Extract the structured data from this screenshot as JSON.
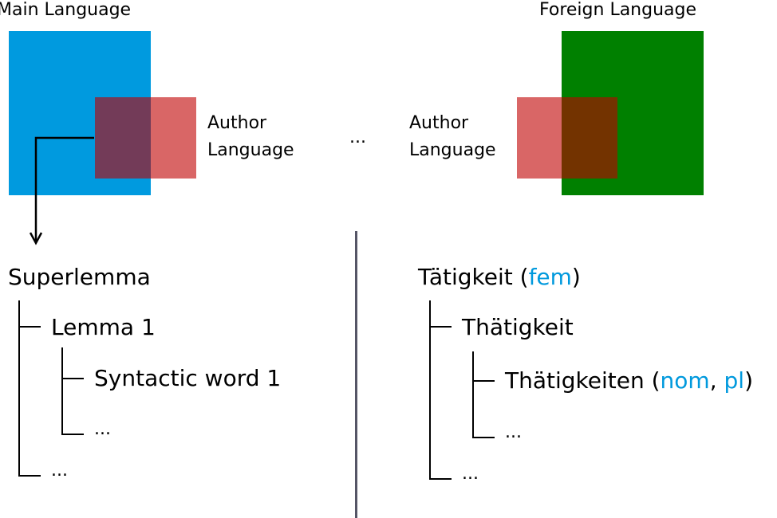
{
  "colors": {
    "main_language": "#009ADF",
    "author_language": "#D96666",
    "main_author_overlap": "#733B58",
    "foreign_language": "#008000",
    "foreign_author_overlap": "#733300",
    "tag_color": "#0099DD",
    "divider": "#555566"
  },
  "top": {
    "main_language_label": "Main Language",
    "foreign_language_label": "Foreign Language",
    "author_language_left": [
      "Author",
      "Language"
    ],
    "author_language_right": [
      "Author",
      "Language"
    ],
    "middle_ellipsis": "..."
  },
  "left_tree": {
    "root": "Superlemma",
    "level1": "Lemma 1",
    "level2": "Syntactic word 1",
    "level2_more": "...",
    "level1_more": "..."
  },
  "right_tree": {
    "root": "Tätigkeit",
    "root_tag": "fem",
    "level1": "Thätigkeit",
    "level2": "Thätigkeiten",
    "level2_tags": [
      "nom",
      "pl"
    ],
    "level2_more": "...",
    "level1_more": "..."
  },
  "punct": {
    "open": " (",
    "close": ")",
    "comma": ", "
  }
}
